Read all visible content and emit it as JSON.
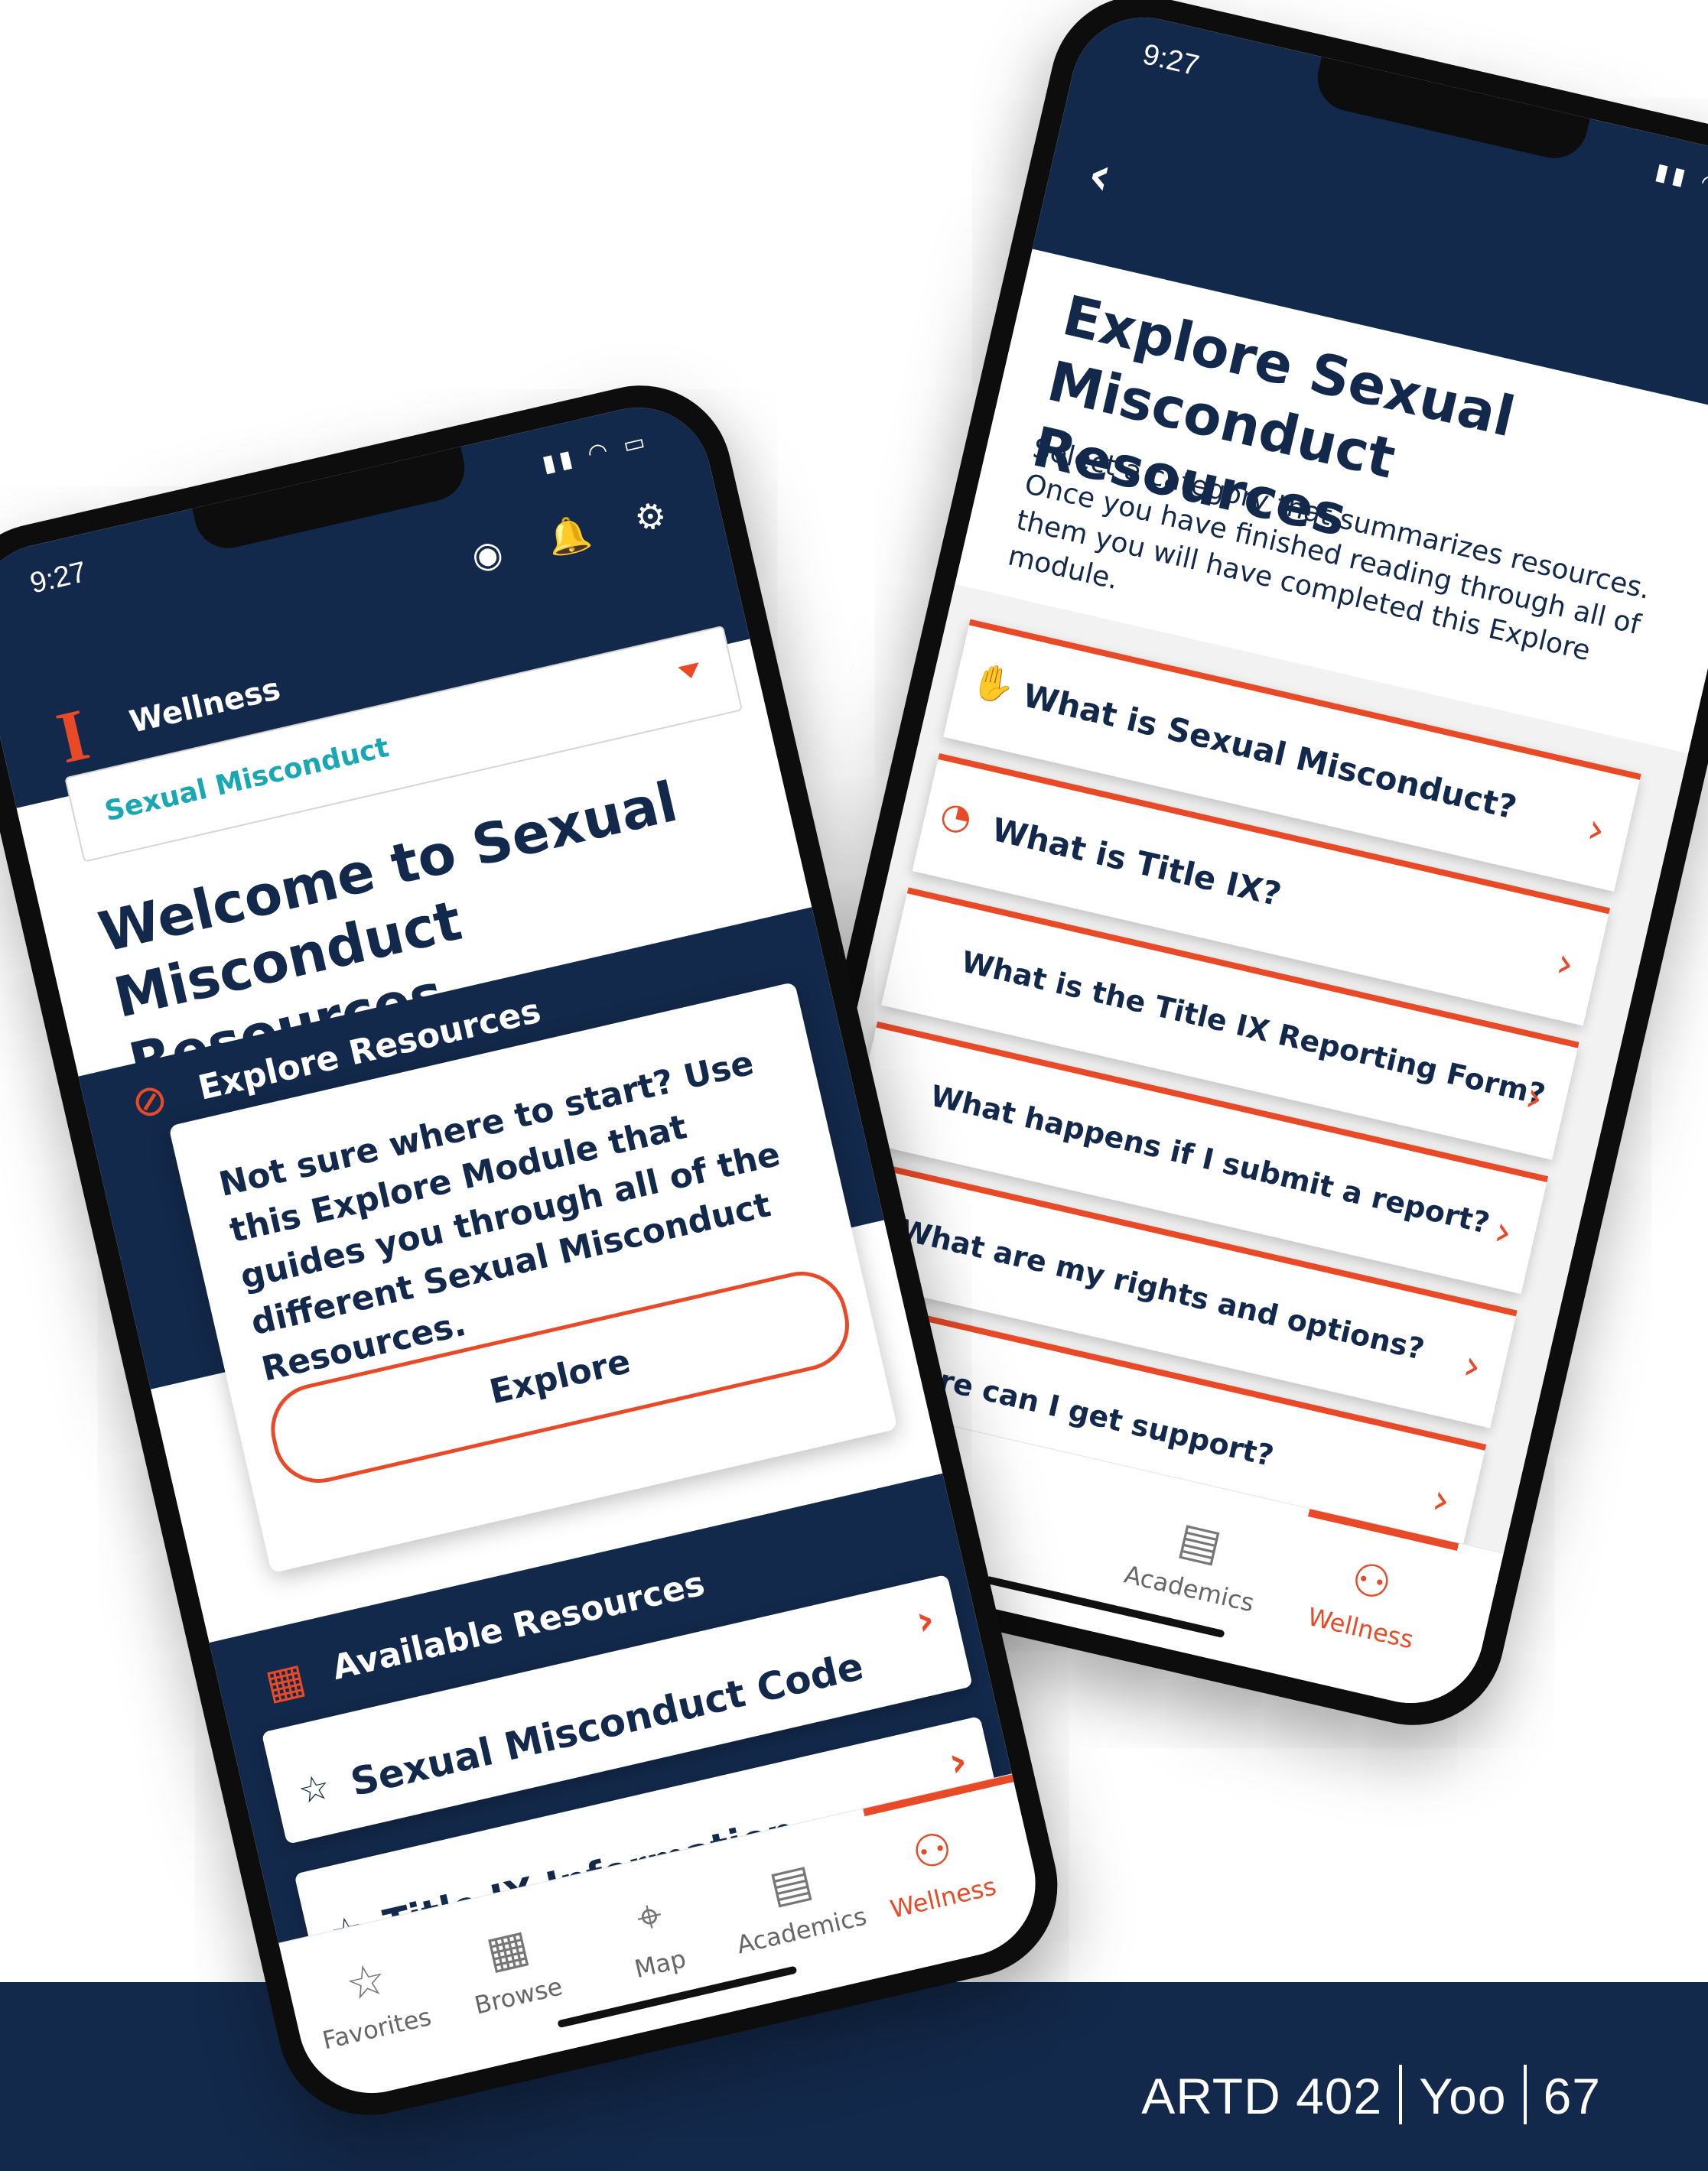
{
  "footer": {
    "course": "ARTD 402",
    "author": "Yoo",
    "page": "67"
  },
  "phone1": {
    "status_time": "9:27",
    "status_icons": "▮▮ ◠ ▭",
    "app_title": "Wellness",
    "logo": "I",
    "top_icons": {
      "profile": "◉",
      "bell": "🔔",
      "settings": "⚙"
    },
    "dropdown_value": "Sexual Misconduct",
    "welcome_title": "Welcome to Sexual Misconduct Resources",
    "explore": {
      "section_title": "Explore Resources",
      "icon": "⊘",
      "card_text": "Not sure where to start? Use this Explore Module that guides you through all of the different Sexual Misconduct Resources.",
      "button_label": "Explore"
    },
    "available": {
      "section_title": "Available Resources",
      "icon": "▦",
      "items": [
        {
          "label": "Sexual Misconduct Code",
          "star": "☆",
          "chevron": "›"
        },
        {
          "label": "Title IX Information",
          "star": "☆",
          "chevron": "›"
        }
      ]
    },
    "tabs": [
      {
        "label": "Favorites",
        "icon": "☆"
      },
      {
        "label": "Browse",
        "icon": "▦"
      },
      {
        "label": "Map",
        "icon": "⌖"
      },
      {
        "label": "Academics",
        "icon": "▤"
      },
      {
        "label": "Wellness",
        "icon": "⚇"
      }
    ],
    "active_tab": "Wellness",
    "accent_color": "#e84a27",
    "navy_color": "#13294b"
  },
  "phone2": {
    "status_time": "9:27",
    "status_icons": "▮▮ ◠ ▭",
    "back": "‹",
    "title": "Explore Sexual Misconduct Resources",
    "description": "Select a category that summarizes resources. Once you have finished reading through all of them you will have completed this Explore module.",
    "items": [
      {
        "label": "What is Sexual Misconduct?",
        "icon": "✋",
        "chevron": "›"
      },
      {
        "label": "What is Title IX?",
        "icon": "◔",
        "chevron": "›"
      },
      {
        "label": "What is the Title IX Reporting Form?",
        "icon": "",
        "chevron": "›"
      },
      {
        "label": "What happens if I submit a report?",
        "icon": "",
        "chevron": "›"
      },
      {
        "label": "What are my rights and options?",
        "icon": "",
        "chevron": "›"
      },
      {
        "label": "Where can I get support?",
        "icon": "",
        "chevron": "›"
      },
      {
        "label": "",
        "icon": "",
        "chevron": "›"
      }
    ],
    "tabs": [
      {
        "label": "Academics",
        "icon": "▤"
      },
      {
        "label": "Wellness",
        "icon": "⚇"
      }
    ],
    "active_tab": "Wellness"
  }
}
